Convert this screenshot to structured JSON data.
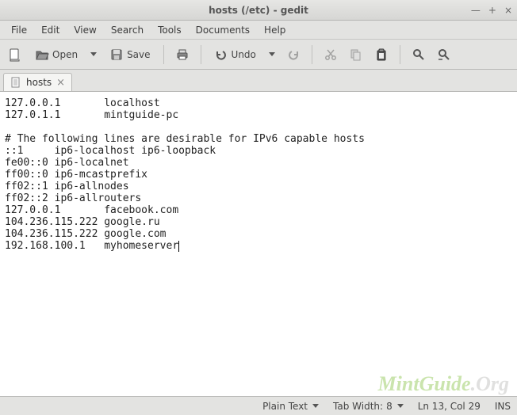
{
  "window": {
    "title": "hosts (/etc) - gedit"
  },
  "menu": {
    "file": "File",
    "edit": "Edit",
    "view": "View",
    "search": "Search",
    "tools": "Tools",
    "documents": "Documents",
    "help": "Help"
  },
  "toolbar": {
    "open": "Open",
    "save": "Save",
    "undo": "Undo"
  },
  "tab": {
    "label": "hosts"
  },
  "editor": {
    "text": "127.0.0.1       localhost\n127.0.1.1       mintguide-pc\n\n# The following lines are desirable for IPv6 capable hosts\n::1     ip6-localhost ip6-loopback\nfe00::0 ip6-localnet\nff00::0 ip6-mcastprefix\nff02::1 ip6-allnodes\nff02::2 ip6-allrouters\n127.0.0.1       facebook.com\n104.236.115.222 google.ru\n104.236.115.222 google.com\n192.168.100.1   myhomeserver"
  },
  "status": {
    "syntax": "Plain Text",
    "tabwidth_label": "Tab Width:",
    "tabwidth_value": "8",
    "position": "Ln 13, Col 29",
    "mode": "INS"
  },
  "watermark": {
    "part1": "MintGuide",
    "part2": ".Org"
  }
}
